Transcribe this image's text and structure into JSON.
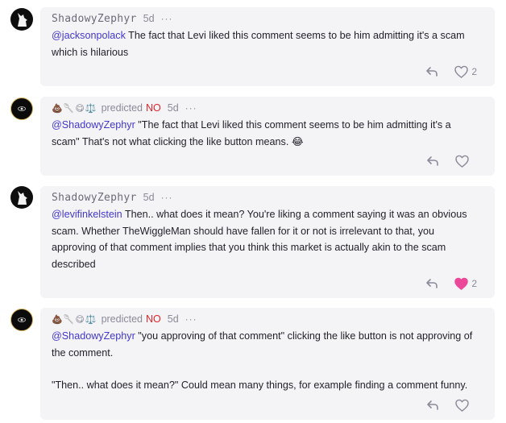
{
  "colors": {
    "mention": "#4338ca",
    "outcome_no": "#e0252a",
    "bubble_bg": "#f4f4f7",
    "liked_heart": "#ec4899"
  },
  "icons": {
    "reply": "reply-arrow-icon",
    "like": "heart-icon",
    "more": "more-dots-icon"
  },
  "comments": [
    {
      "username": "ShadowyZephyr",
      "badges": "",
      "predicted": "",
      "outcome": "",
      "time": "5d",
      "more": "···",
      "mention": "@jacksonpolack",
      "text": " The fact that Levi liked this comment seems to be him admitting it's a scam which is hilarious",
      "likes": "2",
      "liked": false
    },
    {
      "username": "",
      "badges": "💩🥄😋⚖️",
      "predicted": "predicted",
      "outcome": "NO",
      "time": "5d",
      "more": "···",
      "mention": "@ShadowyZephyr",
      "text": " \"The fact that Levi liked this comment seems to be him admitting it's a scam\" That's not what clicking the like button means. 😂",
      "likes": "",
      "liked": false
    },
    {
      "username": "ShadowyZephyr",
      "badges": "",
      "predicted": "",
      "outcome": "",
      "time": "5d",
      "more": "···",
      "mention": "@levifinkelstein",
      "text": " Then.. what does it mean? You're liking a comment saying it was an obvious scam. Whether TheWiggleMan should have fallen for it or not is irrelevant to that, you approving of that comment implies that you think this market is actually akin to the scam described",
      "likes": "2",
      "liked": true
    },
    {
      "username": "",
      "badges": "💩🥄😋⚖️",
      "predicted": "predicted",
      "outcome": "NO",
      "time": "5d",
      "more": "···",
      "mention": "@ShadowyZephyr",
      "text": " \"you approving of that comment\" clicking the like button is not approving of the comment.",
      "text2": "\"Then.. what does it mean?\" Could mean many things, for example finding a comment funny.",
      "likes": "",
      "liked": false
    }
  ]
}
